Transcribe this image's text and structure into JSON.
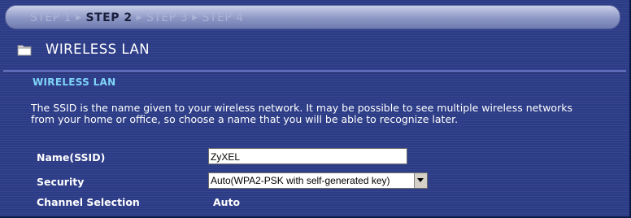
{
  "steps": [
    {
      "label": "STEP 1",
      "active": false
    },
    {
      "label": "STEP 2",
      "active": true
    },
    {
      "label": "STEP 3",
      "active": false
    },
    {
      "label": "STEP 4",
      "active": false
    }
  ],
  "header": {
    "title": "WIRELESS LAN"
  },
  "section": {
    "title": "WIRELESS LAN",
    "description": "The SSID is the name given to your wireless network. It may be possible to see multiple wireless networks from your home or office, so choose a name that you will be able to recognize later."
  },
  "form": {
    "ssid": {
      "label": "Name(SSID)",
      "value": "ZyXEL"
    },
    "security": {
      "label": "Security",
      "value": "Auto(WPA2-PSK with self-generated key)"
    },
    "channel": {
      "label": "Channel Selection",
      "value": "Auto"
    }
  },
  "colors": {
    "background": "#2b3b86",
    "section_title": "#7fd4f8",
    "active_step": "#1a1f3d",
    "inactive_step": "#aab2d6"
  }
}
